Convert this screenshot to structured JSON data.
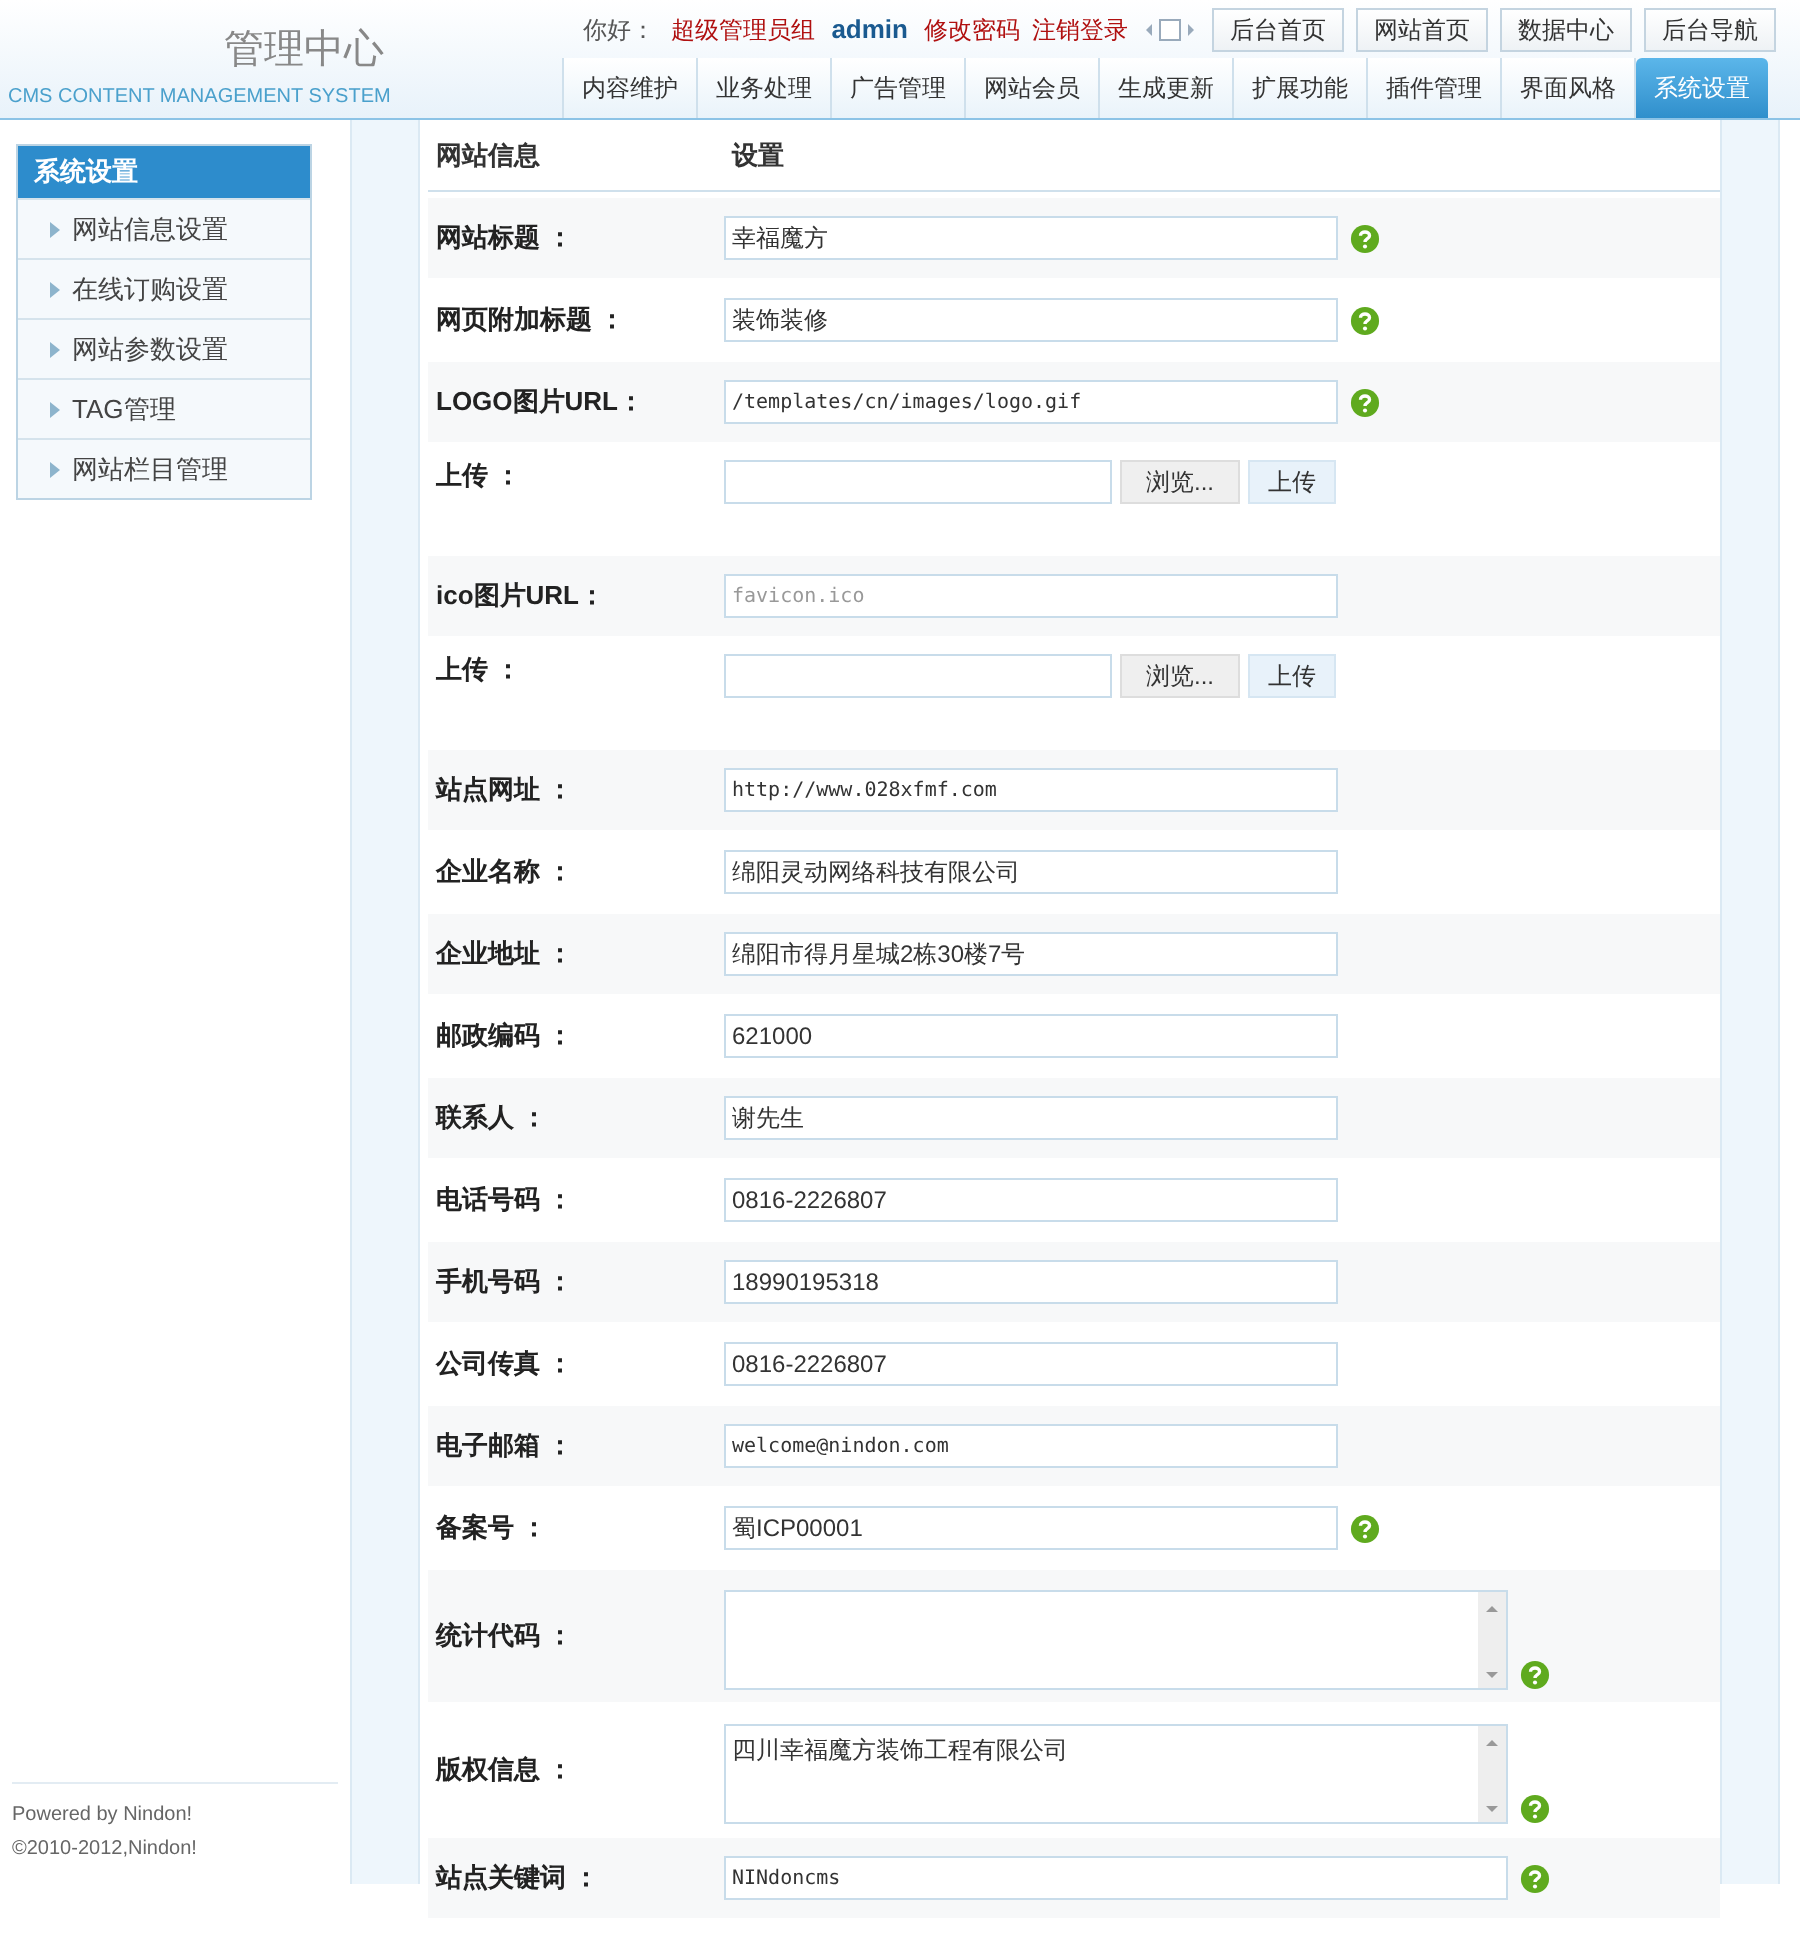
{
  "brand": {
    "title": "管理中心",
    "subtitle": "CMS CONTENT MANAGEMENT SYSTEM"
  },
  "user_bar": {
    "greeting": "你好：",
    "group": "超级管理员组",
    "user": "admin",
    "links": [
      "修改密码",
      "注销登录"
    ]
  },
  "top_buttons": [
    "后台首页",
    "网站首页",
    "数据中心",
    "后台导航"
  ],
  "tabs": [
    {
      "label": "内容维护",
      "selected": false
    },
    {
      "label": "业务处理",
      "selected": false
    },
    {
      "label": "广告管理",
      "selected": false
    },
    {
      "label": "网站会员",
      "selected": false
    },
    {
      "label": "生成更新",
      "selected": false
    },
    {
      "label": "扩展功能",
      "selected": false
    },
    {
      "label": "插件管理",
      "selected": false
    },
    {
      "label": "界面风格",
      "selected": false
    },
    {
      "label": "系统设置",
      "selected": true
    }
  ],
  "sidebar": {
    "title": "系统设置",
    "items": [
      "网站信息设置",
      "在线订购设置",
      "网站参数设置",
      "TAG管理",
      "网站栏目管理"
    ]
  },
  "footer": [
    "Powered by Nindon!",
    "©2010-2012,Nindon!"
  ],
  "form": {
    "columns": [
      "网站信息",
      "设置"
    ],
    "rows": [
      {
        "kind": "text",
        "label": "网站标题 ：",
        "value": "幸福魔方",
        "help": true
      },
      {
        "kind": "text",
        "label": "网页附加标题 ：",
        "value": "装饰装修",
        "help": true
      },
      {
        "kind": "text",
        "label": "LOGO图片URL：",
        "value": "/templates/cn/images/logo.gif",
        "mono": true,
        "help": true
      },
      {
        "kind": "upload",
        "label": "上传 ：",
        "browse": "浏览...",
        "upload": "上传"
      },
      {
        "kind": "text",
        "label": "ico图片URL：",
        "placeholder": "favicon.ico",
        "mono": true
      },
      {
        "kind": "upload",
        "label": "上传 ：",
        "browse": "浏览...",
        "upload": "上传"
      },
      {
        "kind": "text",
        "label": "站点网址 ：",
        "value": "http://www.028xfmf.com",
        "mono": true
      },
      {
        "kind": "text",
        "label": "企业名称 ：",
        "value": "绵阳灵动网络科技有限公司"
      },
      {
        "kind": "text",
        "label": "企业地址 ：",
        "value": "绵阳市得月星城2栋30楼7号"
      },
      {
        "kind": "text",
        "label": "邮政编码 ：",
        "value": "621000"
      },
      {
        "kind": "text",
        "label": "联系人 ：",
        "value": "谢先生"
      },
      {
        "kind": "text",
        "label": "电话号码 ：",
        "value": "0816-2226807"
      },
      {
        "kind": "text",
        "label": "手机号码 ：",
        "value": "18990195318"
      },
      {
        "kind": "text",
        "label": "公司传真 ：",
        "value": "0816-2226807"
      },
      {
        "kind": "text",
        "label": "电子邮箱 ：",
        "value": "welcome@nindon.com",
        "mono": true
      },
      {
        "kind": "text",
        "label": "备案号 ：",
        "value": "蜀ICP00001",
        "help": true
      },
      {
        "kind": "textarea",
        "label": "统计代码 ：",
        "value": "",
        "help": true
      },
      {
        "kind": "textarea",
        "label": "版权信息 ：",
        "value": "四川幸福魔方装饰工程有限公司",
        "help": true
      },
      {
        "kind": "wide",
        "label": "站点关键词 ：",
        "value": "NINdoncms",
        "mono": true,
        "help": true
      }
    ]
  }
}
